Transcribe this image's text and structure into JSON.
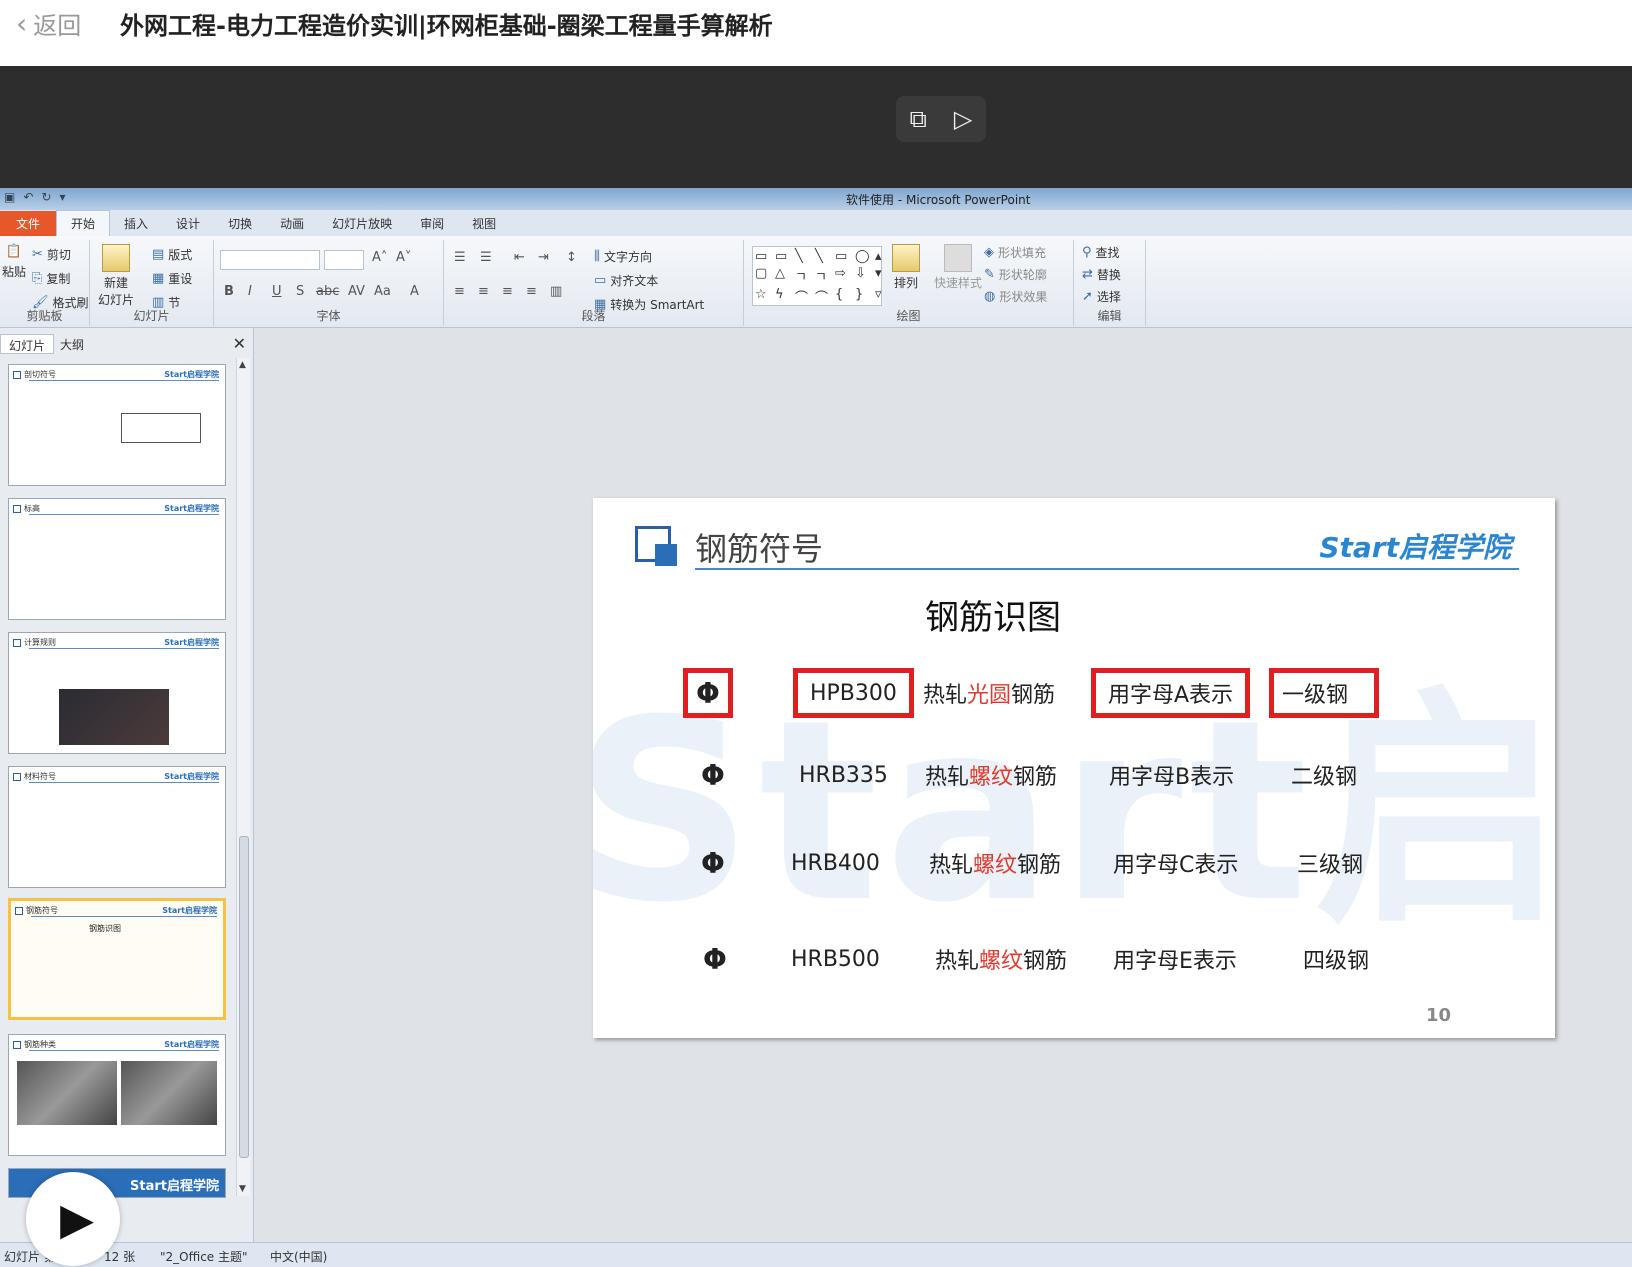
{
  "header": {
    "back_label": "返回",
    "title": "外网工程-电力工程造价实训|环网柜基础-圈梁工程量手算解析"
  },
  "ppt": {
    "window_title": "软件使用 - Microsoft PowerPoint",
    "tabs": [
      "文件",
      "开始",
      "插入",
      "设计",
      "切换",
      "动画",
      "幻灯片放映",
      "审阅",
      "视图"
    ],
    "ribbon": {
      "clipboard": {
        "paste": "粘贴",
        "cut": "剪切",
        "copy": "复制",
        "format_painter": "格式刷",
        "label": "剪贴板"
      },
      "slides": {
        "new_slide": "新建\n幻灯片",
        "layout": "版式",
        "reset": "重设",
        "section": "节",
        "label": "幻灯片"
      },
      "font": {
        "label": "字体"
      },
      "paragraph": {
        "text_dir": "文字方向",
        "align_text": "对齐文本",
        "smartart": "转换为 SmartArt",
        "label": "段落"
      },
      "drawing": {
        "arrange": "排列",
        "quick_styles": "快速样式",
        "fill": "形状填充",
        "outline": "形状轮廓",
        "effects": "形状效果",
        "label": "绘图"
      },
      "editing": {
        "find": "查找",
        "replace": "替换",
        "select": "选择",
        "label": "编辑"
      }
    },
    "panel": {
      "tab_slides": "幻灯片",
      "tab_outline": "大纲"
    },
    "thumbs": [
      {
        "title": "剖切符号",
        "logo": "Start启程学院"
      },
      {
        "title": "标高",
        "logo": "Start启程学院"
      },
      {
        "title": "计算规则",
        "logo": "Start启程学院"
      },
      {
        "title": "材料符号",
        "logo": "Start启程学院"
      },
      {
        "title": "钢筋符号",
        "logo": "Start启程学院"
      },
      {
        "title": "钢筋种类",
        "logo": "Start启程学院"
      },
      {
        "title": "",
        "logo": "Start启程学院"
      }
    ],
    "slide": {
      "title": "钢筋符号",
      "logo": "Start启程学院",
      "subtitle": "钢筋识图",
      "watermark": "Start启程学",
      "page_number": "10",
      "rows": [
        {
          "symbol": "Φ",
          "code": "HPB300",
          "pre": "热轧",
          "key": "光圆",
          "post": "钢筋",
          "letter": "用字母A表示",
          "grade": "一级钢"
        },
        {
          "symbol": "Φ",
          "code": "HRB335",
          "pre": "热轧",
          "key": "螺纹",
          "post": "钢筋",
          "letter": "用字母B表示",
          "grade": "二级钢"
        },
        {
          "symbol": "Φ",
          "code": "HRB400",
          "pre": "热轧",
          "key": "螺纹",
          "post": "钢筋",
          "letter": "用字母C表示",
          "grade": "三级钢"
        },
        {
          "symbol": "Φ",
          "code": "HRB500",
          "pre": "热轧",
          "key": "螺纹",
          "post": "钢筋",
          "letter": "用字母E表示",
          "grade": "四级钢"
        }
      ]
    },
    "status": {
      "slide_info": "幻灯片 第",
      "count": "12 张",
      "theme": "\"2_Office 主题\"",
      "lang": "中文(中国)"
    }
  },
  "colors": {
    "accent_red": "#e02020",
    "brand_blue": "#2a6eb8"
  }
}
